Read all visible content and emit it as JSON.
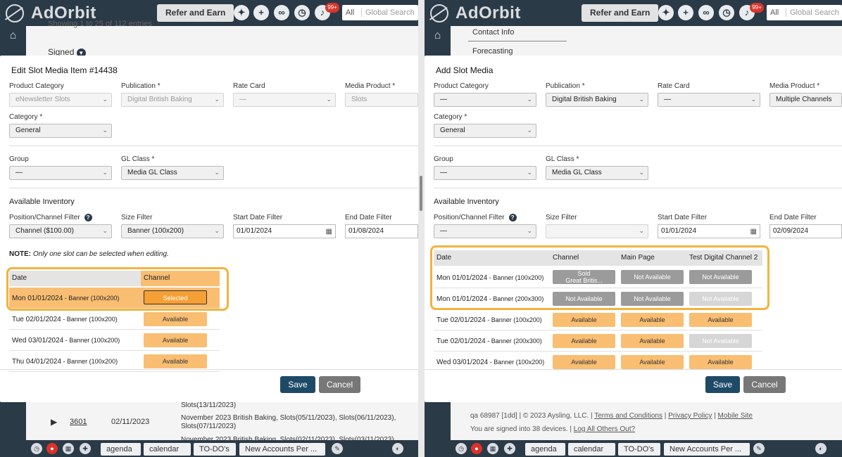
{
  "app": {
    "logo": "AdOrbit",
    "refer_label": "Refer and Earn",
    "notif_badge": "99+",
    "search_scope": "All",
    "search_placeholder": "Global Search"
  },
  "taskbar": {
    "tabs": [
      "agenda",
      "calendar",
      "TO-DO's",
      "New Accounts Per ..."
    ]
  },
  "left_bg": {
    "showing": "Showing 1 to 25 of 112 entries",
    "signed": "Signed",
    "row_num": "3601",
    "row_date": "02/11/2023",
    "row_text1": "November 2023 British Baking, Slots(05/11/2023), Slots(06/11/2023),",
    "row_text2": "Slots(07/11/2023)",
    "row_text_top": "Slots(13/11/2023)",
    "row_text_bottom": "November 2023 British Baking, Slots(02/11/2023), Slots(03/11/2023)"
  },
  "right_bg": {
    "contact_info": "Contact Info",
    "forecasting": "Forecasting",
    "footer_line1": "qa 68987 [1dd] | © 2023 Aysling, LLC. |",
    "terms": "Terms and Conditions",
    "privacy": "Privacy Policy",
    "mobile": "Mobile Site",
    "footer_line2": "You are signed into 38 devices. |",
    "logout": "Log All Others Out?"
  },
  "edit_modal": {
    "title": "Edit Slot Media Item #14438",
    "product_category": {
      "label": "Product Category",
      "value": "eNewsletter Slots"
    },
    "publication": {
      "label": "Publication *",
      "value": "Digital British Baking"
    },
    "rate_card": {
      "label": "Rate Card",
      "value": "—"
    },
    "media_product": {
      "label": "Media Product *",
      "value": "Slots"
    },
    "category": {
      "label": "Category *",
      "value": "General"
    },
    "group": {
      "label": "Group",
      "value": "—"
    },
    "gl_class": {
      "label": "GL Class *",
      "value": "Media GL Class"
    },
    "inventory_title": "Available Inventory",
    "position_filter": {
      "label": "Position/Channel Filter",
      "value": "Channel ($100.00)"
    },
    "size_filter": {
      "label": "Size Filter",
      "value": "Banner (100x200)"
    },
    "start_date": {
      "label": "Start Date Filter",
      "value": "01/01/2024"
    },
    "end_date": {
      "label": "End Date Filter",
      "value": "01/08/2024"
    },
    "note_prefix": "NOTE:",
    "note_text": "Only one slot can be selected when editing.",
    "col_date": "Date",
    "col_channel": "Channel",
    "rows": [
      {
        "date": "Mon 01/01/2024",
        "size": "Banner (100x200)",
        "status": "Selected"
      },
      {
        "date": "Tue 02/01/2024",
        "size": "Banner (100x200)",
        "status": "Available"
      },
      {
        "date": "Wed 03/01/2024",
        "size": "Banner (100x200)",
        "status": "Available"
      },
      {
        "date": "Thu 04/01/2024",
        "size": "Banner (100x200)",
        "status": "Available"
      }
    ],
    "save": "Save",
    "cancel": "Cancel"
  },
  "add_modal": {
    "title": "Add Slot Media",
    "product_category": {
      "label": "Product Category",
      "value": "—"
    },
    "publication": {
      "label": "Publication *",
      "value": "Digital British Baking"
    },
    "rate_card": {
      "label": "Rate Card",
      "value": "—"
    },
    "media_product": {
      "label": "Media Product *",
      "value": "Multiple Channels"
    },
    "category": {
      "label": "Category *",
      "value": "General"
    },
    "group": {
      "label": "Group",
      "value": "—"
    },
    "gl_class": {
      "label": "GL Class *",
      "value": "Media GL Class"
    },
    "inventory_title": "Available Inventory",
    "position_filter": {
      "label": "Position/Channel Filter",
      "value": "—"
    },
    "size_filter": {
      "label": "Size Filter",
      "value": ""
    },
    "start_date": {
      "label": "Start Date Filter",
      "value": "01/01/2024"
    },
    "end_date": {
      "label": "End Date Filter",
      "value": "02/09/2024"
    },
    "col_date": "Date",
    "col_channel": "Channel",
    "col_main": "Main Page",
    "col_test": "Test Digital Channel 2",
    "rows": [
      {
        "date": "Mon 01/01/2024",
        "size": "Banner (100x200)",
        "channel": "Sold\nGreat Britis...",
        "main": "Not Available",
        "test": "Not Available"
      },
      {
        "date": "Mon 01/01/2024",
        "size": "Banner (200x300)",
        "channel": "Not Available",
        "main": "Not Available",
        "test": "Not Available"
      },
      {
        "date": "Tue 02/01/2024",
        "size": "Banner (100x200)",
        "channel": "Available",
        "main": "Available",
        "test": "Available"
      },
      {
        "date": "Tue 02/01/2024",
        "size": "Banner (200x300)",
        "channel": "Available",
        "main": "Available",
        "test": "Not Available"
      },
      {
        "date": "Wed 03/01/2024",
        "size": "Banner (100x200)",
        "channel": "Available",
        "main": "Available",
        "test": "Available"
      }
    ],
    "save": "Save",
    "cancel": "Cancel"
  },
  "colors": {
    "nav": "#2b3a47",
    "available": "#f9be72",
    "selected": "#f5a035",
    "not_available": "#9b9b9b",
    "highlight": "#f1b43c",
    "save": "#1e4a68"
  }
}
